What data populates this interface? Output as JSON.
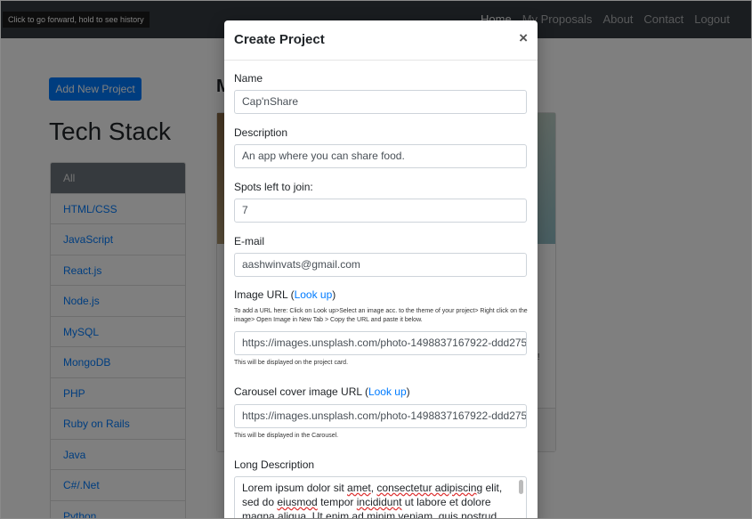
{
  "tooltip": "Click to go forward, hold to see history",
  "nav": {
    "links": [
      "Home",
      "My Proposals",
      "About",
      "Contact",
      "Logout"
    ]
  },
  "sidebar": {
    "add_button": "Add New Project",
    "title": "Tech Stack",
    "items": [
      "All",
      "HTML/CSS",
      "JavaScript",
      "React.js",
      "Node.js",
      "MySQL",
      "MongoDB",
      "PHP",
      "Ruby on Rails",
      "Java",
      "C#/.Net",
      "Python"
    ]
  },
  "main": {
    "heading_partial": "M",
    "card_text_partial": "t!"
  },
  "modal": {
    "title": "Create Project",
    "close": "×",
    "name_label": "Name",
    "name_value": "Cap'nShare",
    "description_label": "Description",
    "description_value": "An app where you can share food.",
    "spots_label": "Spots left to join:",
    "spots_value": "7",
    "email_label": "E-mail",
    "email_value": "aashwinvats@gmail.com",
    "image_url_label": "Image URL (",
    "image_url_link": "Look up",
    "image_url_close": ")",
    "image_url_hint": "To add a URL here: Click on Look up>Select an image acc. to the theme of your project> Right click on the image> Open Image in New Tab > Copy the URL and paste it below.",
    "image_url_value": "https://images.unsplash.com/photo-1498837167922-ddd27525",
    "image_url_help": "This will be displayed on the project card.",
    "carousel_label": "Carousel cover image URL (",
    "carousel_link": "Look up",
    "carousel_close": ")",
    "carousel_value": "https://images.unsplash.com/photo-1498837167922-ddd27525",
    "carousel_help": "This will be displayed in the Carousel.",
    "long_desc_label": "Long Description",
    "long_desc_line1_a": "Lorem ipsum dolor sit ",
    "long_desc_line1_b": "amet",
    "long_desc_line1_c": ", ",
    "long_desc_line1_d": "consectetur adipiscing",
    "long_desc_line1_e": " elit,",
    "long_desc_line2_a": "sed do ",
    "long_desc_line2_b": "eiusmod",
    "long_desc_line2_c": " tempor ",
    "long_desc_line2_d": "incididunt",
    "long_desc_line2_e": " ut labore et dolore",
    "long_desc_line3": "magna aliqua. Ut enim ad minim veniam, quis nostrud"
  }
}
